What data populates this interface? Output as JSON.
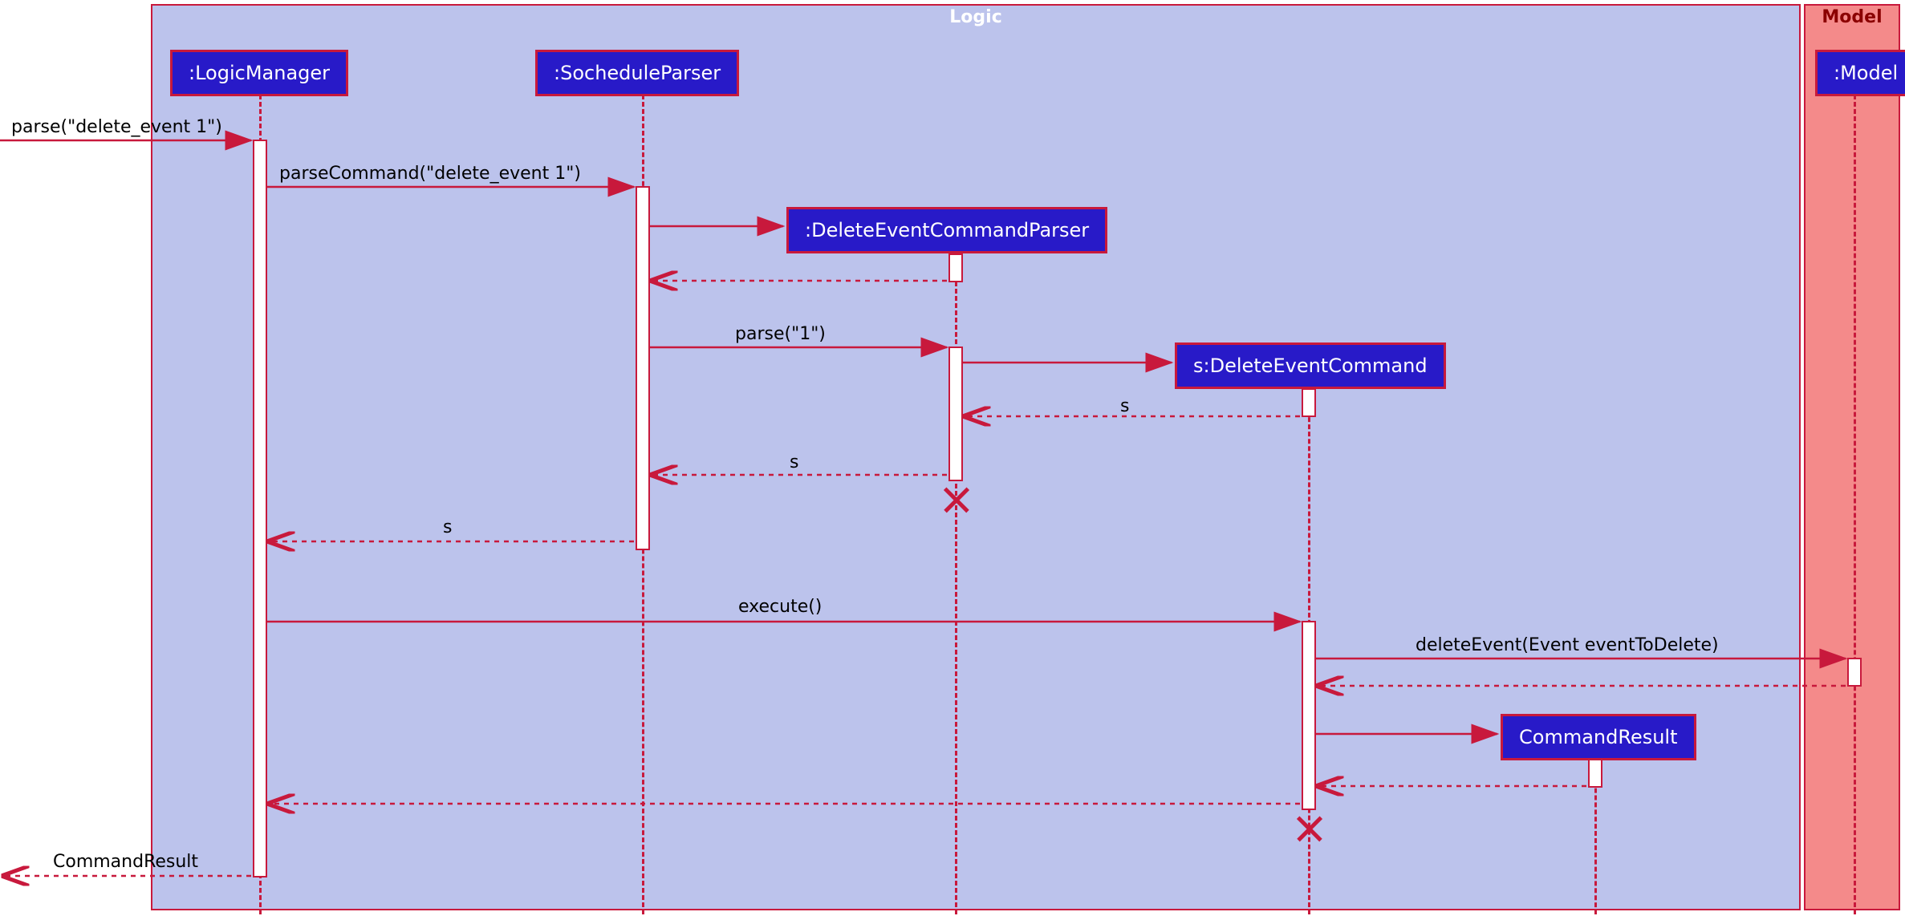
{
  "frames": {
    "logic": {
      "title": "Logic",
      "title_color": "#ffffff",
      "bg": "#bcc3ec"
    },
    "model": {
      "title": "Model",
      "title_color": "#8b0000",
      "bg": "#f48a8a"
    }
  },
  "participants": {
    "logicManager": ":LogicManager",
    "socheduleParser": ":SocheduleParser",
    "deleteParser": ":DeleteEventCommandParser",
    "deleteCmd": "s:DeleteEventCommand",
    "cmdResult": "CommandResult",
    "model": ":Model"
  },
  "messages": {
    "m1": "parse(\"delete_event 1\")",
    "m2": "parseCommand(\"delete_event 1\")",
    "m3": "parse(\"1\")",
    "m4_return_s1": "s",
    "m5_return_s2": "s",
    "m6_return_s3": "s",
    "m7": "execute()",
    "m8": "deleteEvent(Event eventToDelete)",
    "m9_return": "CommandResult"
  },
  "colors": {
    "border": "#c8193c",
    "participant_bg": "#281ac8"
  }
}
